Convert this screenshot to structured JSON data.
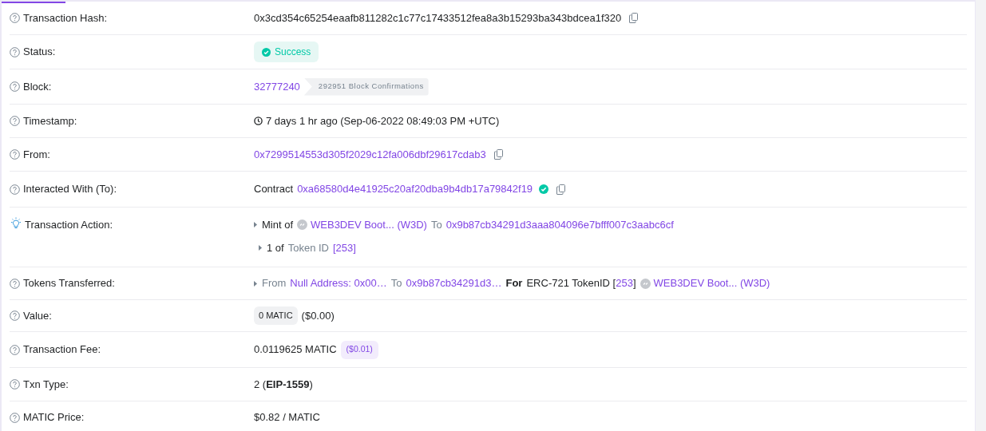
{
  "rows": [
    {
      "label": "Transaction Hash:",
      "kind": "help",
      "lines": [
        [
          {
            "kind": "text",
            "text": "0x3cd354c65254eaafb811282c1c77c17433512fea8a3b15293ba343bdcea1f320"
          },
          {
            "kind": "copy"
          }
        ]
      ]
    },
    {
      "label": "Status:",
      "kind": "help",
      "lines": [
        [
          {
            "kind": "success",
            "text": "Success"
          }
        ]
      ]
    },
    {
      "label": "Block:",
      "kind": "help",
      "lines": [
        [
          {
            "kind": "link",
            "text": "32777240"
          },
          {
            "kind": "confirmations",
            "text": "292951 Block Confirmations"
          }
        ]
      ]
    },
    {
      "label": "Timestamp:",
      "kind": "help",
      "lines": [
        [
          {
            "kind": "clock"
          },
          {
            "kind": "text",
            "text": "7 days 1 hr ago (Sep-06-2022 08:49:03 PM +UTC)"
          }
        ]
      ]
    },
    {
      "label": "From:",
      "kind": "help",
      "lines": [
        [
          {
            "kind": "link",
            "text": "0x7299514553d305f2029c12fa006dbf29617cdab3"
          },
          {
            "kind": "copy"
          }
        ]
      ]
    },
    {
      "label": "Interacted With (To):",
      "kind": "help",
      "lines": [
        [
          {
            "kind": "text",
            "text": "Contract"
          },
          {
            "kind": "link",
            "text": "0xa68580d4e41925c20af20dba9b4db17a79842f19"
          },
          {
            "kind": "verified"
          },
          {
            "kind": "copy"
          }
        ]
      ]
    },
    {
      "label": "Transaction Action:",
      "kind": "bulb",
      "lines": [
        [
          {
            "kind": "caret"
          },
          {
            "kind": "text",
            "text": "Mint of"
          },
          {
            "kind": "token"
          },
          {
            "kind": "link",
            "text": "WEB3DEV Boot... (W3D)"
          },
          {
            "kind": "muted",
            "text": "To"
          },
          {
            "kind": "link",
            "text": "0x9b87cb34291d3aaa804096e7bfff007c3aabc6cf"
          }
        ],
        [
          {
            "kind": "caret"
          },
          {
            "kind": "text",
            "text": "1 of"
          },
          {
            "kind": "muted",
            "text": "Token ID"
          },
          {
            "kind": "link",
            "text": "[253]"
          }
        ]
      ]
    },
    {
      "label": "Tokens Transferred:",
      "kind": "help",
      "lines": [
        [
          {
            "kind": "caret"
          },
          {
            "kind": "muted",
            "text": "From"
          },
          {
            "kind": "link",
            "text": "Null Address: 0x00…"
          },
          {
            "kind": "muted",
            "text": "To"
          },
          {
            "kind": "link",
            "text": "0x9b87cb34291d3…"
          },
          {
            "kind": "bold",
            "text": "For"
          },
          {
            "kind": "id-link",
            "before": "ERC-721 TokenID [",
            "text": "253",
            "after": "]"
          },
          {
            "kind": "token"
          },
          {
            "kind": "link",
            "text": "WEB3DEV Boot... (W3D)"
          }
        ]
      ]
    },
    {
      "label": "Value:",
      "kind": "help",
      "lines": [
        [
          {
            "kind": "pill",
            "text": "0 MATIC"
          },
          {
            "kind": "text",
            "text": "($0.00)"
          }
        ]
      ]
    },
    {
      "label": "Transaction Fee:",
      "kind": "help",
      "lines": [
        [
          {
            "kind": "text",
            "text": "0.0119625 MATIC"
          },
          {
            "kind": "pill-purple",
            "text": "($0.01)"
          }
        ]
      ]
    },
    {
      "label": "Txn Type:",
      "kind": "help",
      "lines": [
        [
          {
            "kind": "text",
            "text": "2 (**EIP-1559**)"
          }
        ]
      ]
    },
    {
      "label": "MATIC Price:",
      "kind": "help",
      "lines": [
        [
          {
            "kind": "text",
            "text": "$0.82 / MATIC"
          }
        ]
      ]
    }
  ]
}
